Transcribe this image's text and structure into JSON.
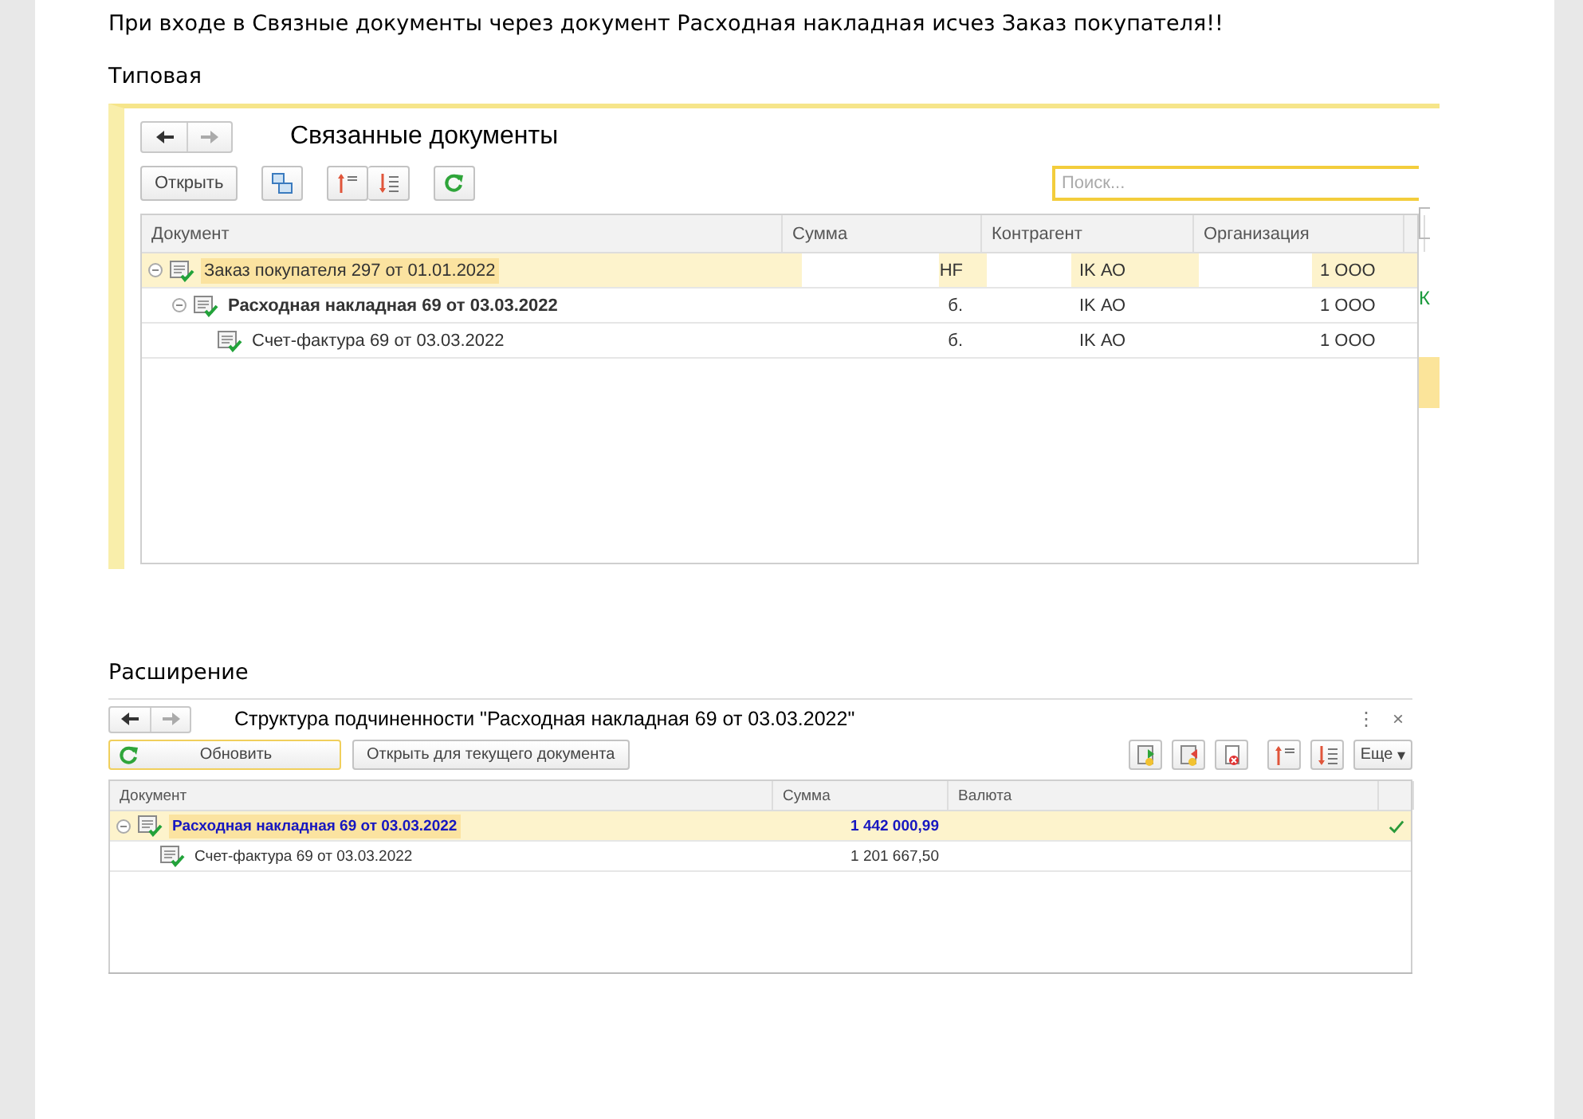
{
  "heading": "При входе в Связные документы через документ Расходная накладная исчез Заказ покупателя!!",
  "standard": {
    "label": "Типовая",
    "title": "Связанные документы",
    "open_button": "Открыть",
    "search": {
      "placeholder": "Поиск..."
    },
    "columns": [
      "Документ",
      "Сумма",
      "Контрагент",
      "Организация"
    ],
    "side_text": "К",
    "rows": [
      {
        "document": "Заказ покупателя 297 от 01.01.2022",
        "selected": true,
        "current": false,
        "expanded": true,
        "sum": "HF",
        "counterparty": "IK АО",
        "organization": "1 ООО",
        "children": [
          {
            "document": "Расходная накладная 69 от 03.03.2022",
            "selected": false,
            "current": true,
            "expanded": true,
            "sum": "б.",
            "counterparty": "IK АО",
            "organization": "1 ООО",
            "children": [
              {
                "document": "Счет-фактура 69 от 03.03.2022",
                "selected": false,
                "current": false,
                "sum": "б.",
                "counterparty": "IK АО",
                "organization": "1 ООО"
              }
            ]
          }
        ]
      }
    ]
  },
  "extension": {
    "label": "Расширение",
    "title": "Структура подчиненности \"Расходная накладная 69 от 03.03.2022\"",
    "refresh_button": "Обновить",
    "open_current_button": "Открыть для текущего документа",
    "more_button": "Еще",
    "more_caret": "▾",
    "menu_glyph": "⋮",
    "close_glyph": "×",
    "columns": [
      "Документ",
      "Сумма",
      "Валюта"
    ],
    "rows": [
      {
        "document": "Расходная накладная 69 от 03.03.2022",
        "selected": true,
        "current": true,
        "expanded": true,
        "checked": true,
        "sum": "1 442 000,99",
        "children": [
          {
            "document": "Счет-фактура 69 от 03.03.2022",
            "selected": false,
            "current": false,
            "checked": false,
            "sum": "1 201 667,50"
          }
        ]
      }
    ]
  }
}
